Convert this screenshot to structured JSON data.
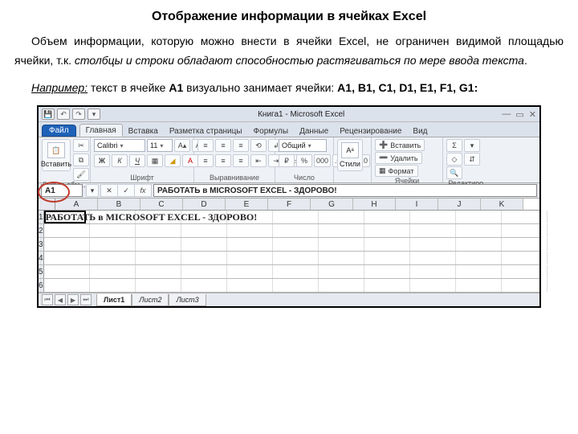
{
  "doc": {
    "title": "Отображение информации в ячейках Excel",
    "p1a": "Объем информации, которую можно внести в ячейки Excel, не огра­ничен видимой площадью ячейки, т.к. ",
    "p1b": "столбцы и строки обладают способностью растягиваться по мере ввода текста",
    "p1c": ".",
    "p2_label": "Например:",
    "p2a": " текст в ячейке ",
    "p2b": "A1",
    "p2c": " визуально занимает ячейки: ",
    "p2d": "A1, B1, C1, D1, E1, F1, G1:"
  },
  "win": {
    "title": "Книга1 - Microsoft Excel",
    "min": "—",
    "restore": "▭",
    "close": "✕"
  },
  "tabs": {
    "file": "Файл",
    "items": [
      "Главная",
      "Вставка",
      "Разметка страницы",
      "Формулы",
      "Данные",
      "Рецензирование",
      "Вид"
    ]
  },
  "ribbon": {
    "clipboard": {
      "label": "Буфер обм...",
      "paste": "Вставить"
    },
    "font": {
      "label": "Шрифт",
      "name": "Calibri",
      "size": "11"
    },
    "align": {
      "label": "Выравнивание"
    },
    "number": {
      "label": "Число",
      "fmt": "Общий"
    },
    "styles": {
      "label": "Стили",
      "btn": "Стили"
    },
    "cells": {
      "label": "Ячейки",
      "insert": "Вставить",
      "delete": "Удалить",
      "format": "Формат"
    },
    "editing": {
      "label": "Редактиро..."
    }
  },
  "fx": {
    "name": "A1",
    "formula": "РАБОТАТЬ в MICROSOFT EXCEL - ЗДОРОВО!"
  },
  "grid": {
    "cols": [
      "A",
      "B",
      "C",
      "D",
      "E",
      "F",
      "G",
      "H",
      "I",
      "J",
      "K"
    ],
    "rows": [
      "1",
      "2",
      "3",
      "4",
      "5",
      "6"
    ],
    "a1": "РАБОТАТЬ в MICROSOFT EXCEL - ЗДОРОВО!"
  },
  "sheets": [
    "Лист1",
    "Лист2",
    "Лист3"
  ]
}
